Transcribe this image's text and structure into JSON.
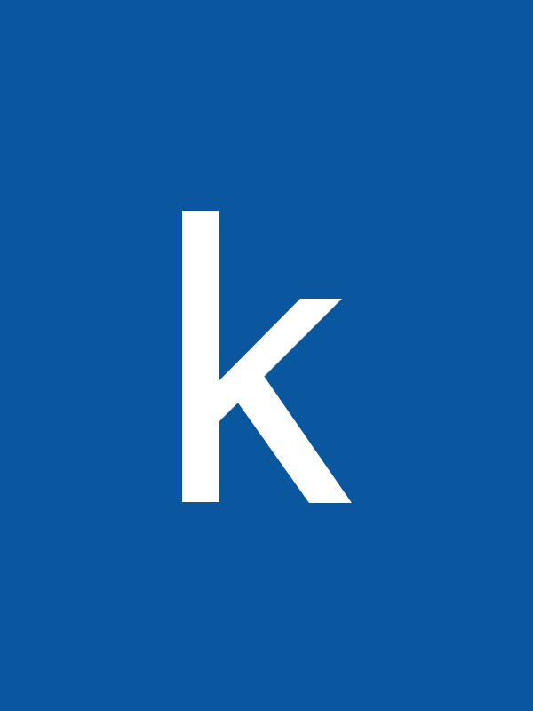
{
  "logo": {
    "letter": "k",
    "icon": "letter-k-logo-icon",
    "background_color": "#0A57A0",
    "letter_color": "#FFFFFF"
  }
}
